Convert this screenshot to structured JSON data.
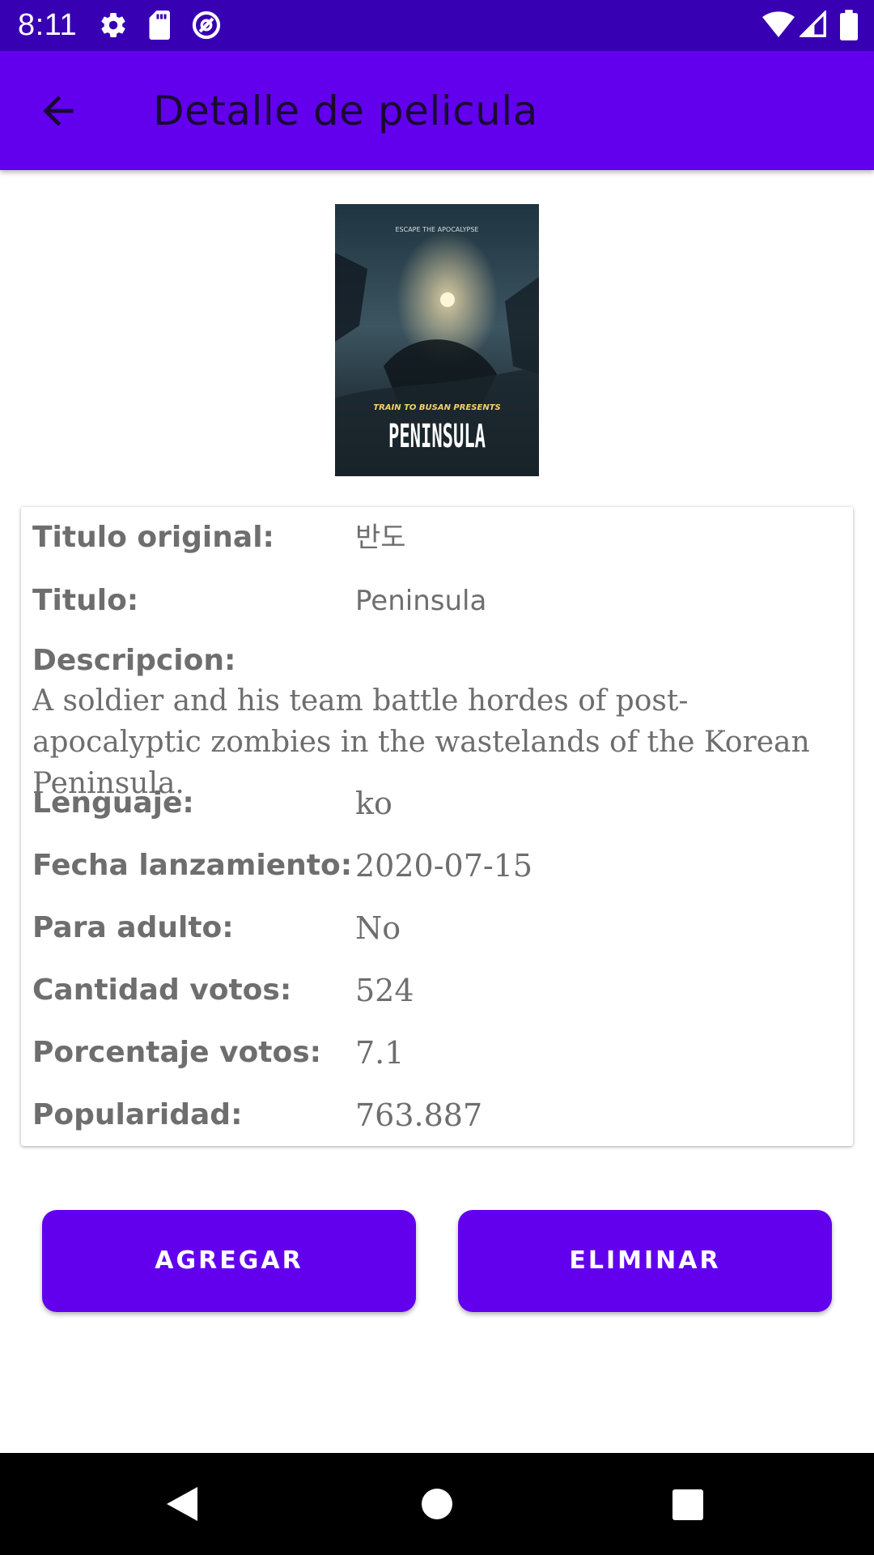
{
  "status_bar": {
    "time": "8:11",
    "left_icons": [
      "settings-icon",
      "sd-card-icon",
      "sync-icon"
    ],
    "right_icons": [
      "wifi-icon",
      "signal-icon",
      "battery-icon"
    ]
  },
  "app_bar": {
    "title": "Detalle de pelicula",
    "back_icon": "arrow-back-icon"
  },
  "poster": {
    "tagline": "ESCAPE THE APOCALYPSE",
    "presenter": "TRAIN TO BUSAN PRESENTS",
    "title": "PENINSULA"
  },
  "details": {
    "original_title_label": "Titulo original:",
    "original_title": "반도",
    "title_label": "Titulo:",
    "title": "Peninsula",
    "description_label": "Descripcion:",
    "description": "A soldier and his team battle hordes of post-apocalyptic zombies in the wastelands of the Korean Peninsula.",
    "language_label": "Lenguaje:",
    "language": "ko",
    "release_label": "Fecha lanzamiento:",
    "release_date": "2020-07-15",
    "adult_label": "Para adulto:",
    "adult": "No",
    "vote_count_label": "Cantidad votos:",
    "vote_count": "524",
    "vote_average_label": "Porcentaje votos:",
    "vote_average": "7.1",
    "popularity_label": "Popularidad:",
    "popularity": "763.887"
  },
  "buttons": {
    "add": "AGREGAR",
    "delete": "ELIMINAR"
  },
  "nav_bar": {
    "icons": [
      "back-triangle-icon",
      "home-circle-icon",
      "recents-square-icon"
    ]
  },
  "colors": {
    "primary": "#6200EE",
    "primary_dark": "#3700B3"
  }
}
